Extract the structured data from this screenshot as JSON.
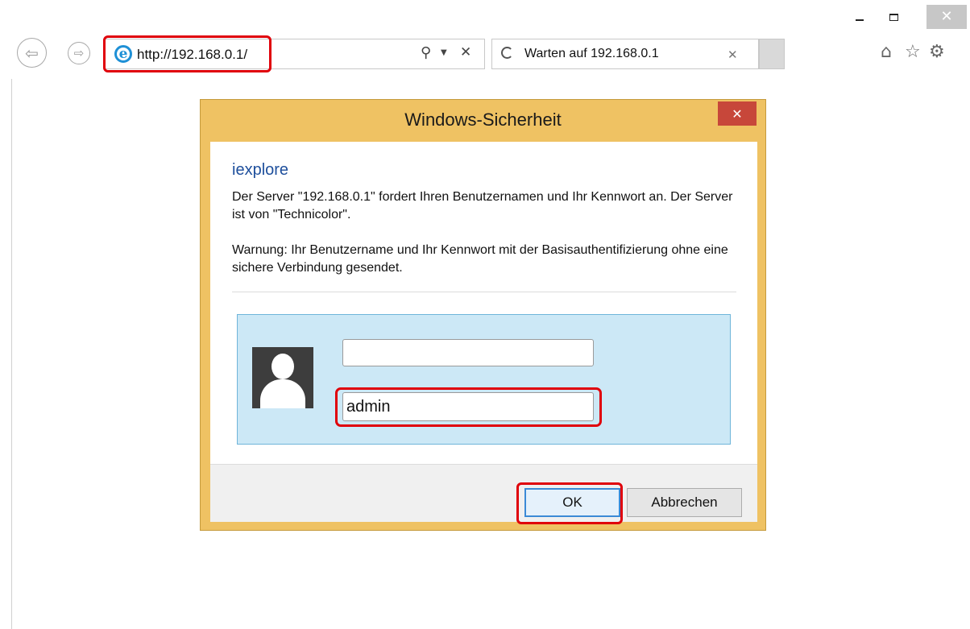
{
  "browser": {
    "url": "http://192.168.0.1/",
    "tab_title": "Warten auf 192.168.0.1",
    "icons": {
      "back": "back-arrow-icon",
      "forward": "forward-arrow-icon",
      "ie": "ie-logo-icon",
      "search": "search-icon",
      "dropdown": "chevron-down-icon",
      "stop": "close-icon",
      "home": "home-icon",
      "favorites": "star-icon",
      "settings": "gear-icon"
    }
  },
  "dialog": {
    "title": "Windows-Sicherheit",
    "app_name": "iexplore",
    "message": "Der Server \"192.168.0.1\" fordert Ihren Benutzernamen und Ihr Kennwort an. Der Server ist von \"Technicolor\".",
    "warning": "Warnung: Ihr Benutzername und Ihr Kennwort mit der Basisauthentifizierung ohne eine sichere Verbindung gesendet.",
    "username_value": "",
    "password_value": "admin",
    "ok_label": "OK",
    "cancel_label": "Abbrechen"
  },
  "colors": {
    "dialog_frame": "#efc263",
    "close_button": "#c7473a",
    "credential_panel": "#cce8f6",
    "highlight": "#e0000a",
    "app_name": "#1e4f9c"
  }
}
